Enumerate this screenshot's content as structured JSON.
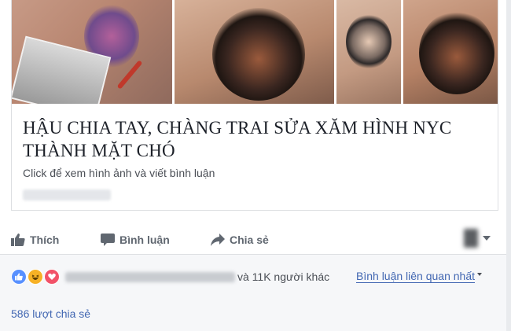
{
  "card": {
    "headline": "HẬU CHIA TAY, CHÀNG TRAI SỬA XĂM HÌNH NYC THÀNH MẶT CHÓ",
    "description": "Click để xem hình ảnh và viết bình luận"
  },
  "actions": {
    "like": "Thích",
    "comment": "Bình luận",
    "share": "Chia sẻ"
  },
  "feedback": {
    "reactions": [
      "like-icon",
      "haha-icon",
      "love-icon"
    ],
    "others": "và 11K người khác",
    "relevant": "Bình luận liên quan nhất",
    "shares": "586 lượt chia sẻ"
  },
  "colors": {
    "link": "#4267b2",
    "action_text": "#606770",
    "like_blue": "#5890ff",
    "haha_yellow": "#f7b125",
    "love_red": "#f25268"
  }
}
